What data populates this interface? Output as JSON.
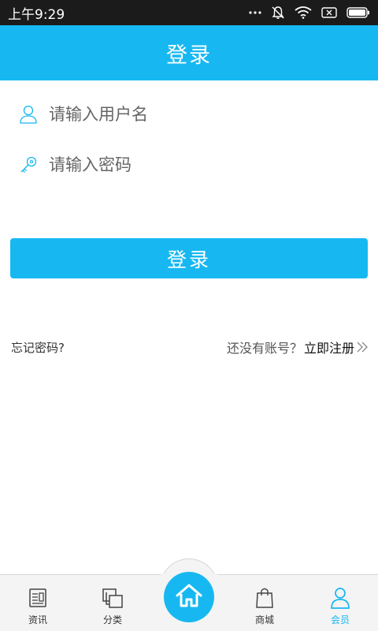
{
  "status_bar": {
    "time": "上午9:29",
    "icons": [
      "more-dots-icon",
      "mute-bell-icon",
      "wifi-icon",
      "close-box-icon",
      "battery-icon"
    ]
  },
  "header": {
    "title": "登录"
  },
  "form": {
    "username_placeholder": "请输入用户名",
    "password_placeholder": "请输入密码",
    "login_button": "登录"
  },
  "links": {
    "forgot_password": "忘记密码?",
    "no_account": "还没有账号？",
    "register": "立即注册"
  },
  "bottom_nav": {
    "items": [
      {
        "label": "资讯",
        "icon": "news-icon"
      },
      {
        "label": "分类",
        "icon": "category-icon"
      },
      {
        "label": "",
        "icon": "home-icon"
      },
      {
        "label": "商城",
        "icon": "shopping-bag-icon"
      },
      {
        "label": "会员",
        "icon": "member-icon",
        "active": true
      }
    ]
  },
  "colors": {
    "accent": "#17b8f2",
    "status_bar": "#1b1b1b",
    "nav_background": "#f4f4f4"
  }
}
